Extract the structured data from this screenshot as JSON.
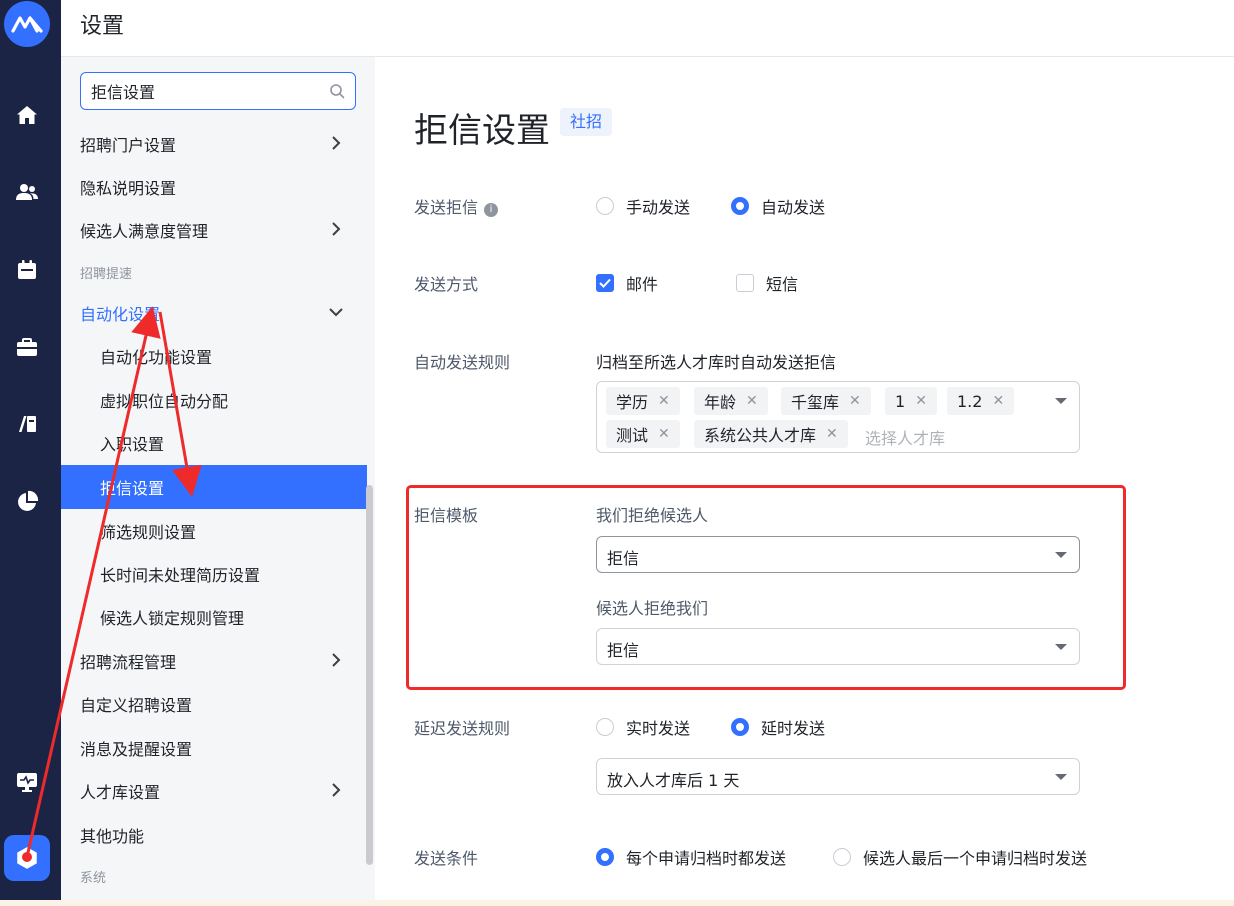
{
  "header": {
    "title": "设置"
  },
  "sidebar": {
    "search": {
      "value": "拒信设置"
    },
    "items": [
      {
        "label": "招聘门户设置",
        "type": "item",
        "chevron": "right"
      },
      {
        "label": "隐私说明设置",
        "type": "item"
      },
      {
        "label": "候选人满意度管理",
        "type": "item",
        "chevron": "right"
      },
      {
        "label": "招聘提速",
        "type": "group"
      },
      {
        "label": "自动化设置",
        "type": "item",
        "chevron": "down",
        "state": "expanded"
      },
      {
        "label": "自动化功能设置",
        "type": "sub"
      },
      {
        "label": "虚拟职位自动分配",
        "type": "sub"
      },
      {
        "label": "入职设置",
        "type": "sub"
      },
      {
        "label": "拒信设置",
        "type": "sub",
        "state": "active"
      },
      {
        "label": "筛选规则设置",
        "type": "sub"
      },
      {
        "label": "长时间未处理简历设置",
        "type": "sub"
      },
      {
        "label": "候选人锁定规则管理",
        "type": "sub"
      },
      {
        "label": "招聘流程管理",
        "type": "item",
        "chevron": "right"
      },
      {
        "label": "自定义招聘设置",
        "type": "item"
      },
      {
        "label": "消息及提醒设置",
        "type": "item"
      },
      {
        "label": "人才库设置",
        "type": "item",
        "chevron": "right"
      },
      {
        "label": "其他功能",
        "type": "item"
      },
      {
        "label": "系统",
        "type": "group"
      }
    ]
  },
  "main": {
    "title": "拒信设置",
    "tag": "社招",
    "send_rejection": {
      "label": "发送拒信",
      "options": [
        "手动发送",
        "自动发送"
      ],
      "selected": "自动发送"
    },
    "send_method": {
      "label": "发送方式",
      "options": [
        "邮件",
        "短信"
      ],
      "checked": [
        "邮件"
      ]
    },
    "auto_rule": {
      "label": "自动发送规则",
      "description": "归档至所选人才库时自动发送拒信",
      "chips": [
        "学历",
        "年龄",
        "千玺库",
        "1",
        "1.2",
        "测试",
        "系统公共人才库"
      ],
      "placeholder": "选择人才库"
    },
    "template": {
      "label": "拒信模板",
      "we_reject": {
        "label": "我们拒绝候选人",
        "value": "拒信"
      },
      "they_reject": {
        "label": "候选人拒绝我们",
        "value": "拒信"
      }
    },
    "delay_rule": {
      "label": "延迟发送规则",
      "options": [
        "实时发送",
        "延时发送"
      ],
      "selected": "延时发送",
      "select_value": "放入人才库后 1 天"
    },
    "condition": {
      "label": "发送条件",
      "options": [
        "每个申请归档时都发送",
        "候选人最后一个申请归档时发送"
      ],
      "selected": "每个申请归档时都发送"
    }
  },
  "colors": {
    "accent": "#3370ff",
    "rail": "#1c2446",
    "annotation": "#ee2a2a"
  }
}
